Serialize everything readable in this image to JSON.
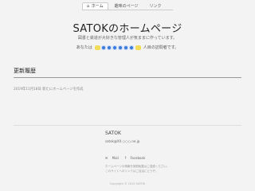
{
  "nav": {
    "tabs": [
      {
        "label": "ホーム",
        "active": true
      },
      {
        "label": "趣味のページ",
        "active": false
      },
      {
        "label": "リンク",
        "active": false
      }
    ]
  },
  "header": {
    "title": "SATOKのホームページ",
    "subtitle": "図書と鉄道が大好きな管理人が気ままに作っています。"
  },
  "visitor": {
    "prefix": "あなたは",
    "suffix": "人目の訪問者です。"
  },
  "updates": {
    "heading": "更新履歴",
    "items": [
      "2019年11月18日 新たにホームページを作成"
    ]
  },
  "footer": {
    "name": "SATOK",
    "email": "satok@XX.○○○.ne.jp",
    "social": {
      "mail": "Mail",
      "facebook": "Facebook"
    },
    "notes": [
      "ホームページの情報を無断転載はご遠慮ください。",
      "このサイトへのリンクはご自由にどうぞ。"
    ],
    "copyright": "Copyright © 2019 SATOK"
  },
  "colors": {
    "background": "#f3f3f3",
    "counter_digit": "#3b7ad6",
    "rule": "#999999"
  }
}
